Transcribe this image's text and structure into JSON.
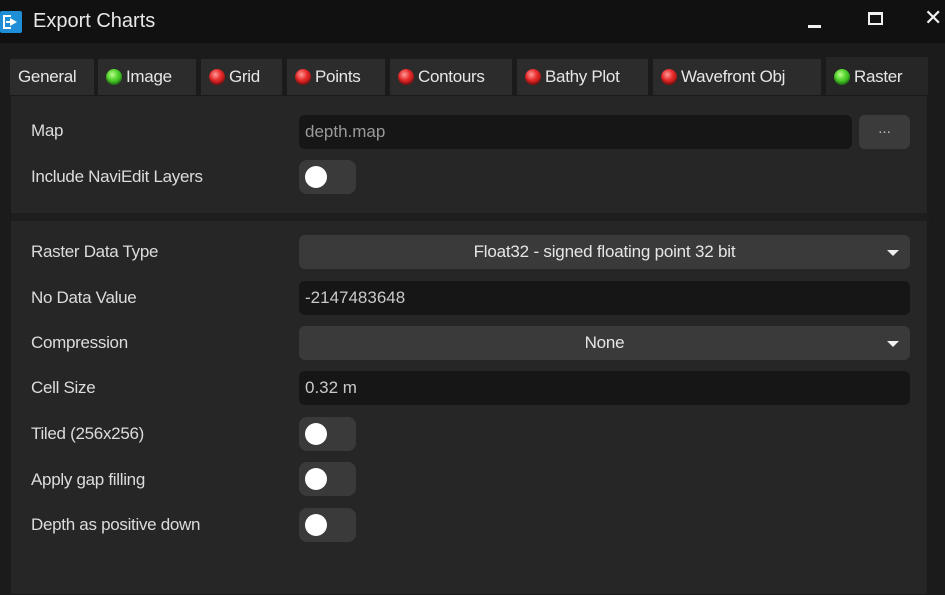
{
  "window": {
    "title": "Export Charts",
    "icon": "export-charts-app-icon",
    "controls": {
      "minimize": "minimize",
      "maximize": "maximize",
      "close": "✕"
    }
  },
  "tabs": [
    {
      "label": "General",
      "status": null
    },
    {
      "label": "Image",
      "status": "green"
    },
    {
      "label": "Grid",
      "status": "red"
    },
    {
      "label": "Points",
      "status": "red"
    },
    {
      "label": "Contours",
      "status": "red"
    },
    {
      "label": "Bathy Plot",
      "status": "red"
    },
    {
      "label": "Wavefront Obj",
      "status": "red"
    },
    {
      "label": "Raster",
      "status": "green",
      "active": true
    }
  ],
  "status_colors": {
    "green": "#4fd12c",
    "red": "#e82a2a"
  },
  "map_section": {
    "map_label": "Map",
    "map_placeholder": "depth.map",
    "browse_label": "...",
    "include_layers_label": "Include NaviEdit Layers",
    "include_layers_on": false
  },
  "raster": {
    "data_type_label": "Raster Data Type",
    "data_type_value": "Float32 - signed floating point 32 bit",
    "no_data_label": "No Data Value",
    "no_data_value": "-2147483648",
    "compression_label": "Compression",
    "compression_value": "None",
    "cell_size_label": "Cell Size",
    "cell_size_value": "0.32 m",
    "tiled_label": "Tiled (256x256)",
    "tiled_on": false,
    "gap_filling_label": "Apply gap filling",
    "gap_filling_on": false,
    "depth_positive_label": "Depth as positive down",
    "depth_positive_on": false
  }
}
